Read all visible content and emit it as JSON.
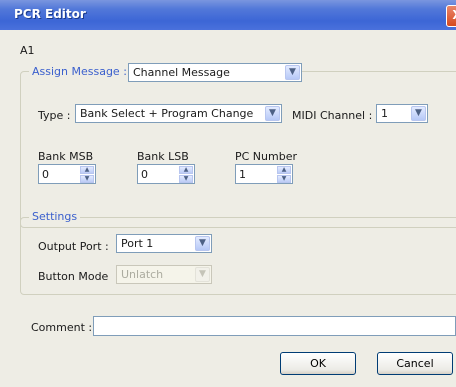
{
  "window": {
    "title": "PCR Editor",
    "close_glyph": "X"
  },
  "control_name": "A1",
  "assign": {
    "legend": "Assign Message :",
    "message_value": "Channel Message",
    "type_label": "Type :",
    "type_value": "Bank Select + Program Change",
    "midi_label": "MIDI Channel :",
    "midi_value": "1",
    "bank_msb_label": "Bank MSB",
    "bank_msb_value": "0",
    "bank_lsb_label": "Bank LSB",
    "bank_lsb_value": "0",
    "pc_label": "PC Number",
    "pc_value": "1"
  },
  "settings": {
    "legend": "Settings",
    "output_label": "Output Port :",
    "output_value": "Port 1",
    "mode_label": "Button Mode",
    "mode_value": "Unlatch"
  },
  "comment": {
    "label": "Comment :",
    "value": ""
  },
  "buttons": {
    "ok": "OK",
    "cancel": "Cancel"
  },
  "icons": {
    "dropdown": "chevron-down-icon",
    "spin_up": "up-arrow-icon",
    "spin_down": "down-arrow-icon"
  }
}
